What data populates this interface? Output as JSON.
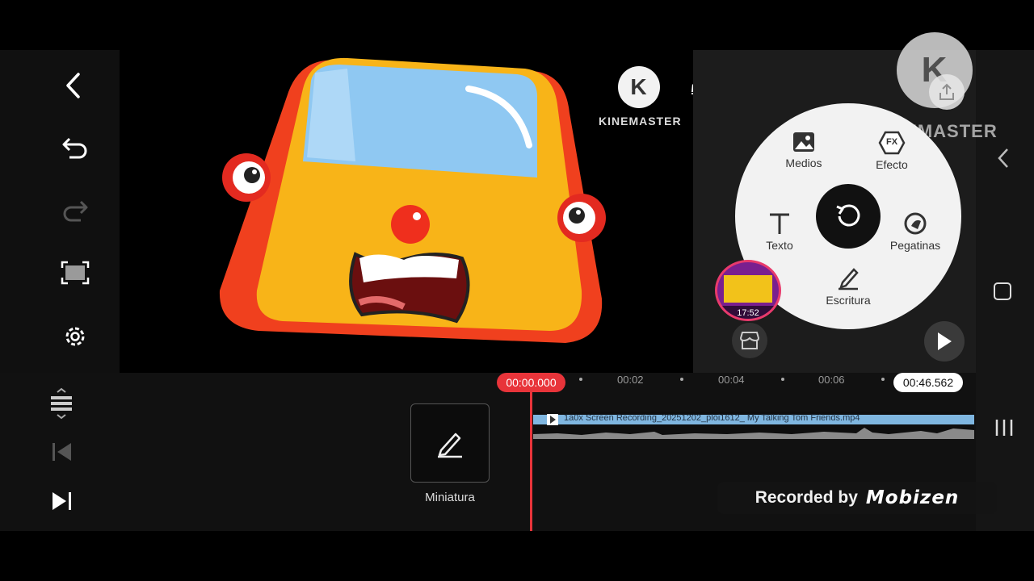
{
  "brand": {
    "logo_letter": "K",
    "name": "KINEMASTER",
    "watermark_name": "KINEMASTER"
  },
  "radial_menu": {
    "media_label": "Medios",
    "effect_label": "Efecto",
    "effect_glyph": "FX",
    "text_label": "Texto",
    "stickers_label": "Pegatinas",
    "handwriting_label": "Escritura"
  },
  "thumbnail": {
    "label": "Miniatura"
  },
  "floating_video": {
    "time": "17:52"
  },
  "timeline": {
    "current_time": "00:00.000",
    "end_time": "00:46.562",
    "ticks": [
      "00:02",
      "00:04",
      "00:06"
    ],
    "clip_name": "1a0x Screen Recording_20251202_ploi1612_ My Talking Tom Friends.mp4"
  },
  "recorder_badge": {
    "prefix": "Recorded by",
    "brand": "Mobizen"
  },
  "colors": {
    "accent_red": "#e8343a",
    "panel_light": "#f2f2f2",
    "car_yellow": "#f8b418",
    "car_red": "#f0401e"
  }
}
